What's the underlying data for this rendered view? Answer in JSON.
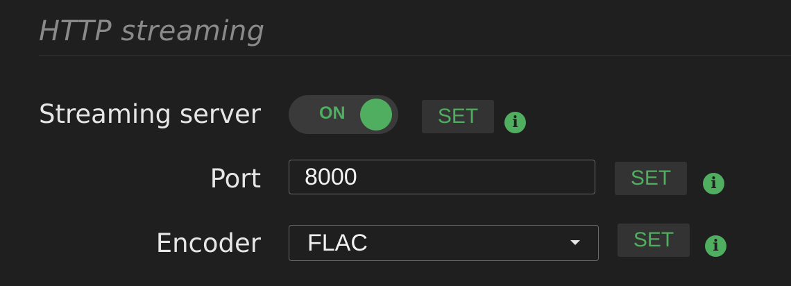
{
  "section": {
    "title": "HTTP streaming"
  },
  "streaming_server": {
    "label": "Streaming server",
    "toggle_state": "ON",
    "set_label": "SET",
    "info_icon": "info-icon"
  },
  "port": {
    "label": "Port",
    "value": "8000",
    "set_label": "SET",
    "info_icon": "info-icon"
  },
  "encoder": {
    "label": "Encoder",
    "selected": "FLAC",
    "set_label": "SET",
    "info_icon": "info-icon",
    "caret_icon": "chevron-down-icon"
  },
  "colors": {
    "background": "#1f1f1f",
    "accent": "#4fae5f",
    "title": "#8a8a8a",
    "label": "#e6e6e6"
  }
}
